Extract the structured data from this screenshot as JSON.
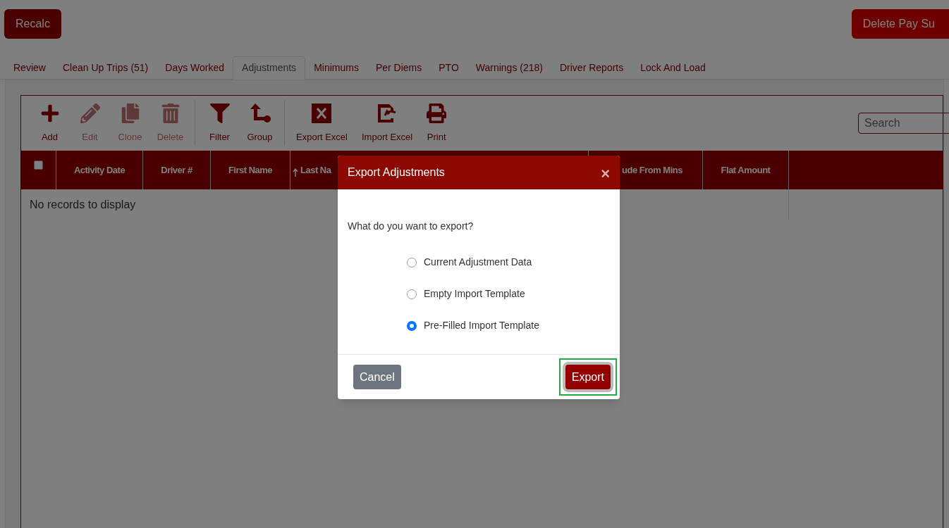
{
  "top_buttons": [
    {
      "label": "Recalc"
    },
    {
      "label": "Delete Pay Su"
    }
  ],
  "tabs": [
    {
      "label": "Review",
      "selected": false
    },
    {
      "label": "Clean Up Trips (51)",
      "selected": false
    },
    {
      "label": "Days Worked",
      "selected": false
    },
    {
      "label": "Adjustments",
      "selected": true
    },
    {
      "label": "Minimums",
      "selected": false
    },
    {
      "label": "Per Diems",
      "selected": false
    },
    {
      "label": "PTO",
      "selected": false
    },
    {
      "label": "Warnings (218)",
      "selected": false
    },
    {
      "label": "Driver Reports",
      "selected": false
    },
    {
      "label": "Lock And Load",
      "selected": false
    }
  ],
  "toolbar": [
    {
      "kind": "add",
      "label": "Add",
      "disabled": false
    },
    {
      "kind": "edit",
      "label": "Edit",
      "disabled": true
    },
    {
      "kind": "clone",
      "label": "Clone",
      "disabled": true
    },
    {
      "kind": "delete",
      "label": "Delete",
      "disabled": true
    },
    {
      "kind": "filter",
      "label": "Filter",
      "disabled": false
    },
    {
      "kind": "group",
      "label": "Group",
      "disabled": false
    },
    {
      "kind": "export",
      "label": "Export Excel",
      "disabled": false
    },
    {
      "kind": "import",
      "label": "Import Excel",
      "disabled": false
    },
    {
      "kind": "print",
      "label": "Print",
      "disabled": false
    }
  ],
  "search": {
    "placeholder": "Search"
  },
  "table": {
    "select_all_checked": false,
    "columns": [
      {
        "label": "Activity Date",
        "sorted": false
      },
      {
        "label": "Driver #",
        "sorted": false
      },
      {
        "label": "First Name",
        "sorted": false
      },
      {
        "label": "Last Na",
        "sorted": true
      },
      {
        "label": "ude From Mins",
        "sorted": false
      },
      {
        "label": "Flat Amount",
        "sorted": false
      }
    ],
    "empty_message": "No records to display"
  },
  "dialog": {
    "title": "Export Adjustments",
    "close": "×",
    "question": "What do you want to export?",
    "options": [
      {
        "label": "Current Adjustment Data",
        "selected": false
      },
      {
        "label": "Empty Import Template",
        "selected": false
      },
      {
        "label": "Pre-Filled Import Template",
        "selected": true
      }
    ],
    "cancel": "Cancel",
    "confirm": {
      "label": "Export",
      "focused": true
    }
  }
}
